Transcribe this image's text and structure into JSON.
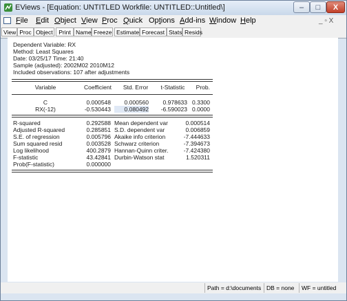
{
  "window": {
    "title": "EViews - [Equation: UNTITLED   Workfile: UNTITLED::Untitled\\]",
    "controls": {
      "minimize": "–",
      "maximize": "□",
      "close": "X"
    }
  },
  "menubar": {
    "items": [
      {
        "label": "File",
        "accel": "F",
        "rest": "ile"
      },
      {
        "label": "Edit",
        "accel": "E",
        "rest": "dit"
      },
      {
        "label": "Object",
        "accel": "O",
        "rest": "bject"
      },
      {
        "label": "View",
        "accel": "V",
        "rest": "iew"
      },
      {
        "label": "Proc",
        "accel": "P",
        "rest": "roc"
      },
      {
        "label": "Quick",
        "accel": "Q",
        "rest": "uick"
      },
      {
        "label": "Options",
        "accel": "O",
        "pre": "Op",
        "accel2": "t",
        "rest": "ions"
      },
      {
        "label": "Add-ins",
        "accel": "A",
        "rest": "dd-ins"
      },
      {
        "label": "Window",
        "accel": "W",
        "rest": "indow"
      },
      {
        "label": "Help",
        "accel": "H",
        "rest": "elp"
      }
    ],
    "mdi_controls": "_ ▫ X"
  },
  "toolbar": {
    "buttons": [
      "View",
      "Proc",
      "Object",
      "Print",
      "Name",
      "Freeze",
      "Estimate",
      "Forecast",
      "Stats",
      "Resids"
    ]
  },
  "output": {
    "header": [
      "Dependent Variable: RX",
      "Method: Least Squares",
      "Date: 03/25/17   Time: 21:40",
      "Sample (adjusted): 2002M02 2010M12",
      "Included observations: 107 after adjustments"
    ],
    "coef_table": {
      "columns": [
        "Variable",
        "Coefficient",
        "Std. Error",
        "t-Statistic",
        "Prob."
      ],
      "rows": [
        [
          "C",
          "0.000548",
          "0.000560",
          "0.978633",
          "0.3300"
        ],
        [
          "RX(-12)",
          "-0.530443",
          "0.080492",
          "-6.590023",
          "0.0000"
        ]
      ]
    },
    "stats": [
      [
        "R-squared",
        "0.292588",
        "Mean dependent var",
        "0.000514"
      ],
      [
        "Adjusted R-squared",
        "0.285851",
        "S.D. dependent var",
        "0.006859"
      ],
      [
        "S.E. of regression",
        "0.005796",
        "Akaike info criterion",
        "-7.444633"
      ],
      [
        "Sum squared resid",
        "0.003528",
        "Schwarz criterion",
        "-7.394673"
      ],
      [
        "Log likelihood",
        "400.2879",
        "Hannan-Quinn criter.",
        "-7.424380"
      ],
      [
        "F-statistic",
        "43.42841",
        "Durbin-Watson stat",
        "1.520311"
      ],
      [
        "Prob(F-statistic)",
        "0.000000",
        "",
        ""
      ]
    ]
  },
  "statusbar": {
    "path": "Path = d:\\documents",
    "db": "DB = none",
    "wf": "WF = untitled"
  }
}
